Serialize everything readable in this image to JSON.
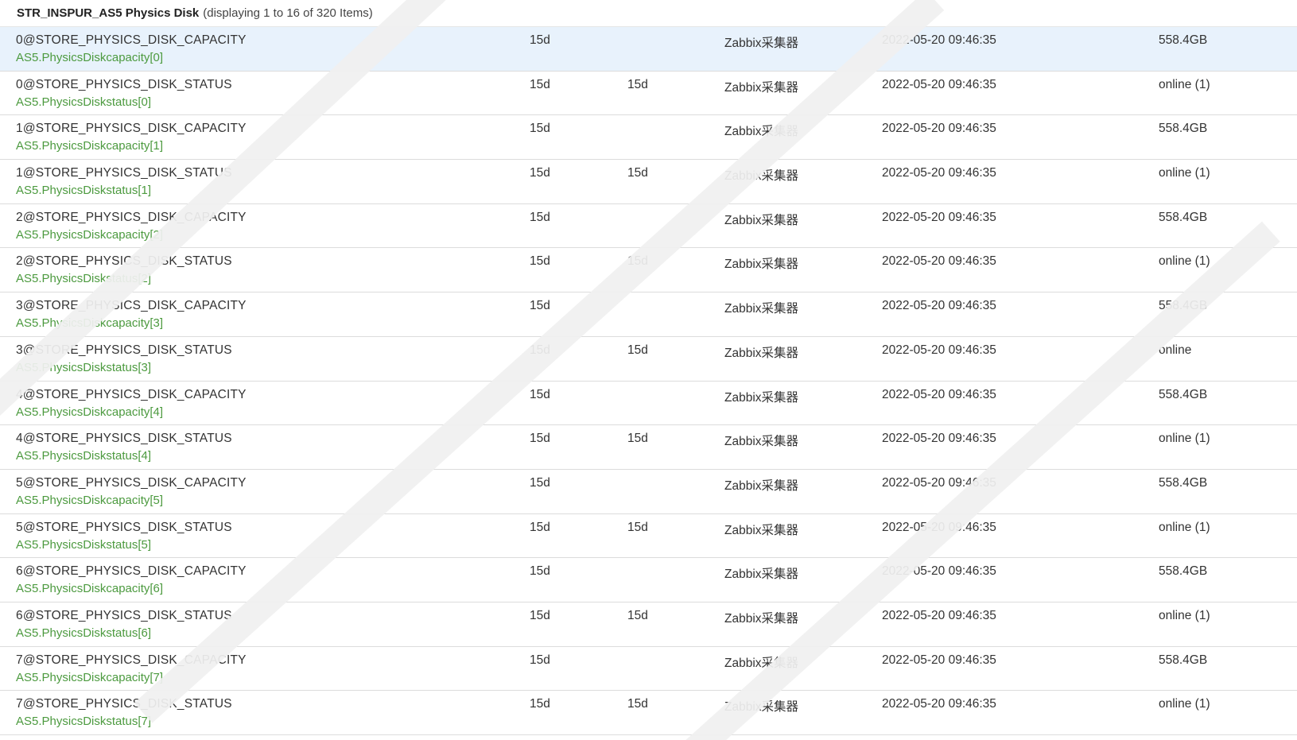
{
  "header": {
    "title": "STR_INSPUR_AS5 Physics Disk",
    "count_text": "(displaying 1 to 16 of 320 Items)"
  },
  "rows": [
    {
      "name": "0@STORE_PHYSICS_DISK_CAPACITY",
      "key": "AS5.PhysicsDiskcapacity[0]",
      "history": "15d",
      "trends": "",
      "type": "Zabbix采集器",
      "last_check": "2022-05-20 09:46:35",
      "last_value": "558.4GB"
    },
    {
      "name": "0@STORE_PHYSICS_DISK_STATUS",
      "key": "AS5.PhysicsDiskstatus[0]",
      "history": "15d",
      "trends": "15d",
      "type": "Zabbix采集器",
      "last_check": "2022-05-20 09:46:35",
      "last_value": "online (1)"
    },
    {
      "name": "1@STORE_PHYSICS_DISK_CAPACITY",
      "key": "AS5.PhysicsDiskcapacity[1]",
      "history": "15d",
      "trends": "",
      "type": "Zabbix采集器",
      "last_check": "2022-05-20 09:46:35",
      "last_value": "558.4GB"
    },
    {
      "name": "1@STORE_PHYSICS_DISK_STATUS",
      "key": "AS5.PhysicsDiskstatus[1]",
      "history": "15d",
      "trends": "15d",
      "type": "Zabbix采集器",
      "last_check": "2022-05-20 09:46:35",
      "last_value": "online (1)"
    },
    {
      "name": "2@STORE_PHYSICS_DISK_CAPACITY",
      "key": "AS5.PhysicsDiskcapacity[2]",
      "history": "15d",
      "trends": "",
      "type": "Zabbix采集器",
      "last_check": "2022-05-20 09:46:35",
      "last_value": "558.4GB"
    },
    {
      "name": "2@STORE_PHYSICS_DISK_STATUS",
      "key": "AS5.PhysicsDiskstatus[2]",
      "history": "15d",
      "trends": "15d",
      "type": "Zabbix采集器",
      "last_check": "2022-05-20 09:46:35",
      "last_value": "online (1)"
    },
    {
      "name": "3@STORE_PHYSICS_DISK_CAPACITY",
      "key": "AS5.PhysicsDiskcapacity[3]",
      "history": "15d",
      "trends": "",
      "type": "Zabbix采集器",
      "last_check": "2022-05-20 09:46:35",
      "last_value": "558.4GB"
    },
    {
      "name": "3@STORE_PHYSICS_DISK_STATUS",
      "key": "AS5.PhysicsDiskstatus[3]",
      "history": "15d",
      "trends": "15d",
      "type": "Zabbix采集器",
      "last_check": "2022-05-20 09:46:35",
      "last_value": "online"
    },
    {
      "name": "4@STORE_PHYSICS_DISK_CAPACITY",
      "key": "AS5.PhysicsDiskcapacity[4]",
      "history": "15d",
      "trends": "",
      "type": "Zabbix采集器",
      "last_check": "2022-05-20 09:46:35",
      "last_value": "558.4GB"
    },
    {
      "name": "4@STORE_PHYSICS_DISK_STATUS",
      "key": "AS5.PhysicsDiskstatus[4]",
      "history": "15d",
      "trends": "15d",
      "type": "Zabbix采集器",
      "last_check": "2022-05-20 09:46:35",
      "last_value": "online (1)"
    },
    {
      "name": "5@STORE_PHYSICS_DISK_CAPACITY",
      "key": "AS5.PhysicsDiskcapacity[5]",
      "history": "15d",
      "trends": "",
      "type": "Zabbix采集器",
      "last_check": "2022-05-20 09:46:35",
      "last_value": "558.4GB"
    },
    {
      "name": "5@STORE_PHYSICS_DISK_STATUS",
      "key": "AS5.PhysicsDiskstatus[5]",
      "history": "15d",
      "trends": "15d",
      "type": "Zabbix采集器",
      "last_check": "2022-05-20 09:46:35",
      "last_value": "online (1)"
    },
    {
      "name": "6@STORE_PHYSICS_DISK_CAPACITY",
      "key": "AS5.PhysicsDiskcapacity[6]",
      "history": "15d",
      "trends": "",
      "type": "Zabbix采集器",
      "last_check": "2022-05-20 09:46:35",
      "last_value": "558.4GB"
    },
    {
      "name": "6@STORE_PHYSICS_DISK_STATUS",
      "key": "AS5.PhysicsDiskstatus[6]",
      "history": "15d",
      "trends": "15d",
      "type": "Zabbix采集器",
      "last_check": "2022-05-20 09:46:35",
      "last_value": "online (1)"
    },
    {
      "name": "7@STORE_PHYSICS_DISK_CAPACITY",
      "key": "AS5.PhysicsDiskcapacity[7]",
      "history": "15d",
      "trends": "",
      "type": "Zabbix采集器",
      "last_check": "2022-05-20 09:46:35",
      "last_value": "558.4GB"
    },
    {
      "name": "7@STORE_PHYSICS_DISK_STATUS",
      "key": "AS5.PhysicsDiskstatus[7]",
      "history": "15d",
      "trends": "15d",
      "type": "Zabbix采集器",
      "last_check": "2022-05-20 09:46:35",
      "last_value": "online (1)"
    }
  ],
  "colors": {
    "selected_row_bg": "#e8f2fc",
    "item_key_text": "#4c9a3f",
    "row_border": "#dcdcdc"
  }
}
